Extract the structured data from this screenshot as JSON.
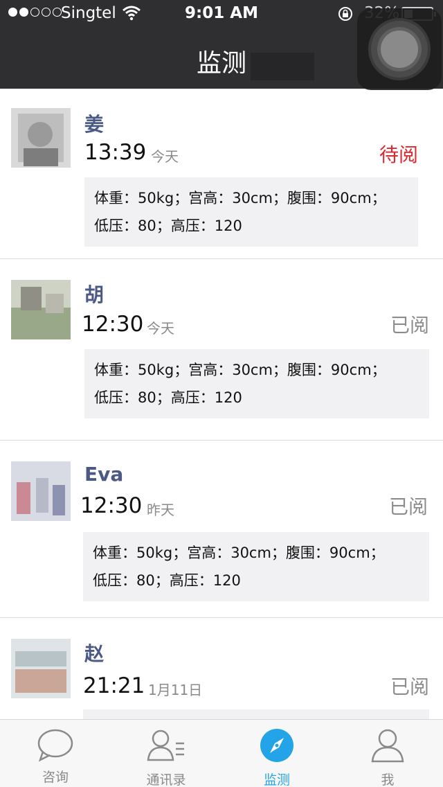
{
  "status_bar": {
    "carrier": "Singtel",
    "time": "9:01 AM",
    "battery_percent": "32%",
    "battery_level": 0.32,
    "signal_bars_filled": 2,
    "signal_bars_total": 5
  },
  "nav": {
    "title": "监测"
  },
  "records": [
    {
      "name": "姜",
      "time": "13:39",
      "day": "今天",
      "status": "待阅",
      "status_kind": "unread",
      "line1": "体重：50kg；宫高：30cm；腹围：90cm；",
      "line2": "低压：80；高压：120"
    },
    {
      "name": "胡",
      "time": "12:30",
      "day": "今天",
      "status": "已阅",
      "status_kind": "read",
      "line1": "体重：50kg；宫高：30cm；腹围：90cm；",
      "line2": "低压：80；高压：120"
    },
    {
      "name": "Eva",
      "time": "12:30",
      "day": "昨天",
      "status": "已阅",
      "status_kind": "read",
      "line1": "体重：50kg；宫高：30cm；腹围：90cm；",
      "line2": "低压：80；高压：120"
    },
    {
      "name": "赵",
      "time": "21:21",
      "day": "1月11日",
      "status": "已阅",
      "status_kind": "read",
      "line1": "",
      "line2": ""
    }
  ],
  "tabs": [
    {
      "label": "咨询",
      "icon": "chat-bubble-icon"
    },
    {
      "label": "通讯录",
      "icon": "contacts-icon"
    },
    {
      "label": "监测",
      "icon": "compass-icon",
      "active": true
    },
    {
      "label": "我",
      "icon": "person-icon"
    }
  ],
  "colors": {
    "accent": "#23a3e8",
    "unread": "#e0272d",
    "name": "#4b5a84",
    "header": "#2f2f31"
  }
}
